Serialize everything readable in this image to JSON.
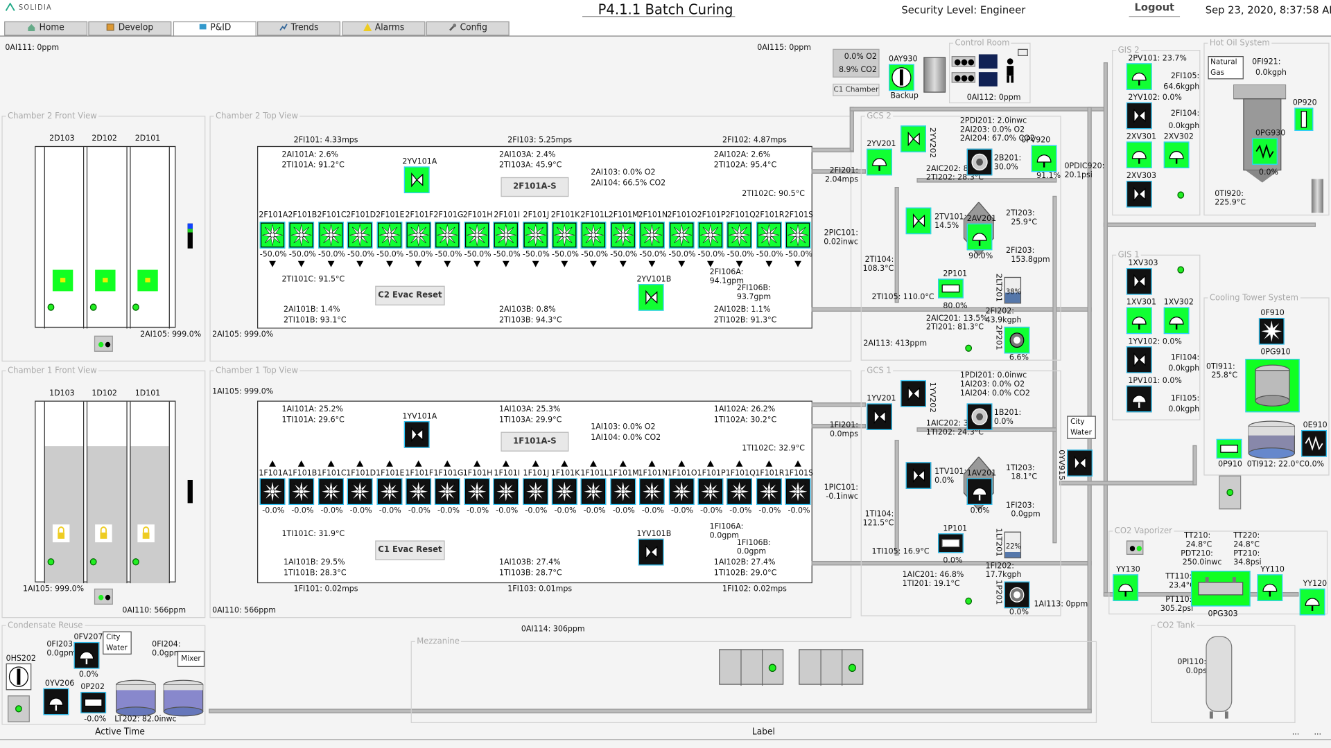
{
  "header": {
    "logo": "SOLIDIA",
    "title": "P4.1.1 Batch Curing",
    "security": "Security Level: Engineer",
    "logout": "Logout",
    "datetime": "Sep 23, 2020, 8:37:58 AM"
  },
  "tabs": [
    {
      "label": "Home"
    },
    {
      "label": "Develop"
    },
    {
      "label": "P&ID"
    },
    {
      "label": "Trends"
    },
    {
      "label": "Alarms"
    },
    {
      "label": "Config"
    }
  ],
  "top": {
    "oai111": "0AI111: 0ppm",
    "oai115": "0AI115: 0ppm",
    "o2": "0.0% O2",
    "co2": "8.9% CO2",
    "c1chamber": "C1 Chamber",
    "oay930": "0AY930",
    "backup": "Backup",
    "oai112": "0AI112: 0ppm",
    "control_room": "Control Room"
  },
  "ch2front": {
    "title": "Chamber 2 Front View",
    "cols": [
      "2D103",
      "2D102",
      "2D101"
    ],
    "ai105": "2AI105: 999.0%"
  },
  "ch2top": {
    "title": "Chamber 2 Top View",
    "fi101": "2FI101: 4.33mps",
    "fi103": "2FI103: 5.25mps",
    "fi102": "2FI102: 4.87mps",
    "l1": "2AI101A: 2.6%",
    "l2": "2TI101A: 91.2°C",
    "yv101a": "2YV101A",
    "m1": "2AI103A: 2.4%",
    "m2": "2TI103A: 45.9°C",
    "r1": "2AI102A: 2.6%",
    "r2": "2TI102A: 95.4°C",
    "ai103": "2AI103: 0.0% O2",
    "ai104": "2AI104: 66.5% CO2",
    "ti102c": "2TI102C: 90.5°C",
    "f101as": "2F101A-S",
    "fanlabels": [
      "2F101A",
      "2F101B",
      "2F101C",
      "2F101D",
      "2F101E",
      "2F101F",
      "2F101G",
      "2F101H",
      "2F101I",
      "2F101J",
      "2F101K",
      "2F101L",
      "2F101M",
      "2F101N",
      "2F101O",
      "2F101P",
      "2F101Q",
      "2F101R",
      "2F101S"
    ],
    "fanval": "-50.0%",
    "ti101c": "2TI101C: 91.5°C",
    "evac": "C2 Evac Reset",
    "yv101b": "2YV101B",
    "b1": "2AI101B: 1.4%",
    "b2": "2TI101B: 93.1°C",
    "bm1": "2AI103B: 0.8%",
    "bm2": "2TI103B: 94.3°C",
    "br1": "2AI102B: 1.1%",
    "br2": "2TI102B: 91.3°C",
    "fi106a": "2FI106A:",
    "fi106a_v": "94.1gpm",
    "fi106b": "2FI106B:",
    "fi106b_v": "93.7gpm",
    "ai105": "2AI105: 999.0%"
  },
  "ch1front": {
    "title": "Chamber 1 Front View",
    "cols": [
      "1D103",
      "1D102",
      "1D101"
    ],
    "ai105": "1AI105: 999.0%",
    "oai110": "0AI110: 566ppm"
  },
  "ch1top": {
    "title": "Chamber 1 Top View",
    "ai105": "1AI105: 999.0%",
    "l1": "1AI101A: 25.2%",
    "l2": "1TI101A: 29.6°C",
    "yv101a": "1YV101A",
    "m1": "1AI103A: 25.3%",
    "m2": "1TI103A: 29.9°C",
    "r1": "1AI102A: 26.2%",
    "r2": "1TI102A: 30.2°C",
    "ai103": "1AI103: 0.0% O2",
    "ai104": "1AI104: 0.0% CO2",
    "ti102c": "1TI102C: 32.9°C",
    "f101as": "1F101A-S",
    "fanlabels": [
      "1F101A",
      "1F101B",
      "1F101C",
      "1F101D",
      "1F101E",
      "1F101F",
      "1F101G",
      "1F101H",
      "1F101I",
      "1F101J",
      "1F101K",
      "1F101L",
      "1F101M",
      "1F101N",
      "1F101O",
      "1F101P",
      "1F101Q",
      "1F101R",
      "1F101S"
    ],
    "fanval": "-0.0%",
    "ti101c": "1TI101C: 31.9°C",
    "evac": "C1 Evac Reset",
    "yv101b": "1YV101B",
    "b1": "1AI101B: 29.5%",
    "b2": "1TI101B: 28.3°C",
    "bm1": "1AI103B: 27.4%",
    "bm2": "1TI103B: 28.7°C",
    "br1": "1AI102B: 27.4%",
    "br2": "1TI102B: 29.0°C",
    "fi101": "1FI101: 0.02mps",
    "fi103": "1FI103: 0.01mps",
    "fi102": "1FI102: 0.02mps",
    "oai110": "0AI110: 566ppm",
    "fi106a": "1FI106A:",
    "fi106a_v": "0.0gpm",
    "fi106b": "1FI106B:",
    "fi106b_v": "0.0gpm"
  },
  "gcs2": {
    "title": "GCS 2",
    "pdi201": "2PDI201: 2.0inwc",
    "ai203": "2AI203: 0.0% O2",
    "ai204": "2AI204: 67.0% CO2",
    "yv201": "2YV201",
    "yv202": "2YV202",
    "fi201": "2FI201:",
    "fi201v": "2.04mps",
    "aic202": "2AIC202: 83.7%",
    "ti202": "2TI202: 28.3°C",
    "b201": "2B201:",
    "b201v": "30.0%",
    "opv920": "0PV920",
    "opv920v": "91.1%",
    "opdic920": "0PDIC920:",
    "opdic920v": "20.1psi",
    "pic101": "2PIC101:",
    "pic101v": "0.02inwc",
    "tv101": "2TV101:",
    "tv101v": "14.5%",
    "av201": "2AV201",
    "av201v": "90.0%",
    "ti203": "2TI203:",
    "ti203v": "25.9°C",
    "fi203": "2FI203:",
    "fi203v": "153.8gpm",
    "ti104": "2TI104:",
    "ti104v": "108.3°C",
    "p101": "2P101",
    "p101v": "80.0%",
    "ti105": "2TI105: 110.0°C",
    "lt201": "2LT201",
    "lt201v": "38%",
    "fi202": "2FI202:",
    "fi202v": "43.9kgph",
    "aic201": "2AIC201: 13.5%",
    "ti201": "2TI201: 81.3°C",
    "p201": "2P201",
    "p201v": "6.6%",
    "ai113": "2AI113: 413ppm"
  },
  "gcs1": {
    "title": "GCS 1",
    "pdi201": "1PDI201: 0.0inwc",
    "ai203": "1AI203: 0.0% O2",
    "ai204": "1AI204: 0.0% CO2",
    "yv201": "1YV201",
    "yv202": "1YV202",
    "fi201": "1FI201:",
    "fi201v": "0.0mps",
    "aic202": "1AIC202: 35.2%",
    "ti202": "1TI202: 24.3°C",
    "b201": "1B201:",
    "b201v": "0.0%",
    "pic101": "1PIC101:",
    "pic101v": "-0.1inwc",
    "tv101": "1TV101:",
    "tv101v": "0.0%",
    "av201": "1AV201",
    "av201v": "0.0%",
    "ti203": "1TI203:",
    "ti203v": "18.1°C",
    "fi203": "1FI203:",
    "fi203v": "0.0gpm",
    "ti104": "1TI104:",
    "ti104v": "121.5°C",
    "p101": "1P101",
    "p101v": "0.0%",
    "ti105": "1TI105: 16.9°C",
    "lt201": "1LT201",
    "lt201v": "22%",
    "fi202": "1FI202:",
    "fi202v": "17.7kgph",
    "aic201": "1AIC201: 46.8%",
    "ti201": "1TI201: 19.1°C",
    "p201": "1P201",
    "p201v": "0.0%",
    "ai113": "1AI113: 0ppm",
    "city": "City Water",
    "oyv915": "0YV915"
  },
  "gis2": {
    "title": "GIS 2",
    "pv101": "2PV101: 23.7%",
    "yv102": "2YV102: 0.0%",
    "fi105": "2FI105:",
    "fi105v": "64.6kgph",
    "fi104": "2FI104:",
    "fi104v": "0.0kgph",
    "xv301": "2XV301",
    "xv302": "2XV302",
    "xv303": "2XV303"
  },
  "gis1": {
    "title": "GIS 1",
    "xv303": "1XV303",
    "xv301": "1XV301",
    "xv302": "1XV302",
    "yv102": "1YV102: 0.0%",
    "fi104": "1FI104:",
    "fi104v": "0.0kgph",
    "pv101": "1PV101: 0.0%",
    "fi105": "1FI105:",
    "fi105v": "0.0kgph"
  },
  "hotoil": {
    "title": "Hot Oil System",
    "gas": "Natural Gas",
    "fi921": "0FI921:",
    "fi921v": "0.0kgph",
    "p920": "0P920",
    "pg930": "0PG930",
    "pg930v": "0.0%",
    "ti920": "0TI920:",
    "ti920v": "225.9°C"
  },
  "cooling": {
    "title": "Cooling Tower System",
    "f910": "0F910",
    "pg910": "0PG910",
    "ti911": "0TI911:",
    "ti911v": "25.8°C",
    "e910": "0E910",
    "e910v": "0.0%",
    "p910": "0P910",
    "ti912": "0TI912: 22.0°C"
  },
  "co2vap": {
    "title": "CO2 Vaporizer",
    "yy130": "YY130",
    "tt210": "TT210:",
    "tt210v": "24.8°C",
    "pdt210": "PDT210:",
    "pdt210v": "250.0inwc",
    "tt220": "TT220:",
    "tt220v": "24.8°C",
    "pt210": "PT210:",
    "pt210v": "34.8psi",
    "tt110": "TT110:",
    "tt110v": "23.4°C",
    "pt110": "PT110:",
    "pt110v": "305.2psi",
    "yy110": "YY110",
    "yy120": "YY120",
    "pg303": "0PG303"
  },
  "co2tank": {
    "title": "CO2 Tank",
    "pi110": "0PI110:",
    "pi110v": "0.0psi"
  },
  "condensate": {
    "title": "Condensate Reuse",
    "fi203": "0FI203:",
    "fi203v": "0.0gpm",
    "fv207": "0FV207",
    "fv207v": "0.0%",
    "city": "City Water",
    "fi204": "0FI204:",
    "fi204v": "0.0gpm",
    "mixer": "Mixer",
    "hs202": "0HS202",
    "yv206": "0YV206",
    "p202": "0P202",
    "p202v": "-0.0%",
    "lt202": "LT202: 82.0inwc"
  },
  "mezz": {
    "title": "Mezzanine",
    "oai114": "0AI114: 306ppm"
  },
  "footer": {
    "active": "Active Time",
    "label": "Label",
    "dots": "..."
  }
}
